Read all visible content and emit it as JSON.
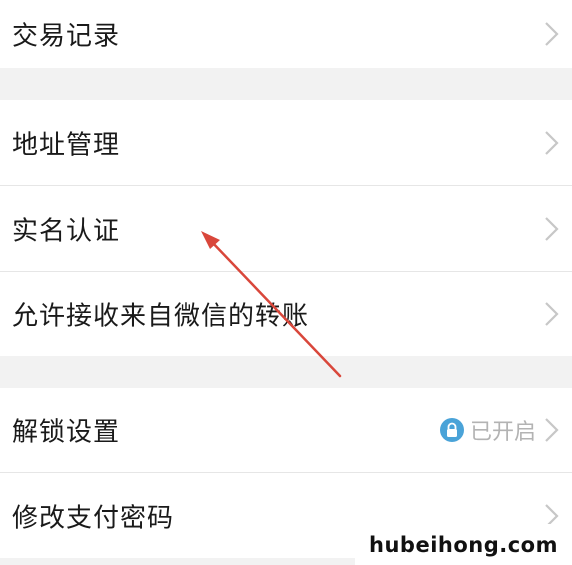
{
  "menu": {
    "items": [
      {
        "label": "交易记录"
      },
      {
        "label": "地址管理"
      },
      {
        "label": "实名认证"
      },
      {
        "label": "允许接收来自微信的转账"
      },
      {
        "label": "解锁设置",
        "status": "已开启"
      },
      {
        "label": "修改支付密码"
      }
    ]
  },
  "status_icon": "lock-icon",
  "annotation": {
    "arrow_color": "#d9473b"
  },
  "watermark": {
    "text": "hubeihong.com"
  }
}
